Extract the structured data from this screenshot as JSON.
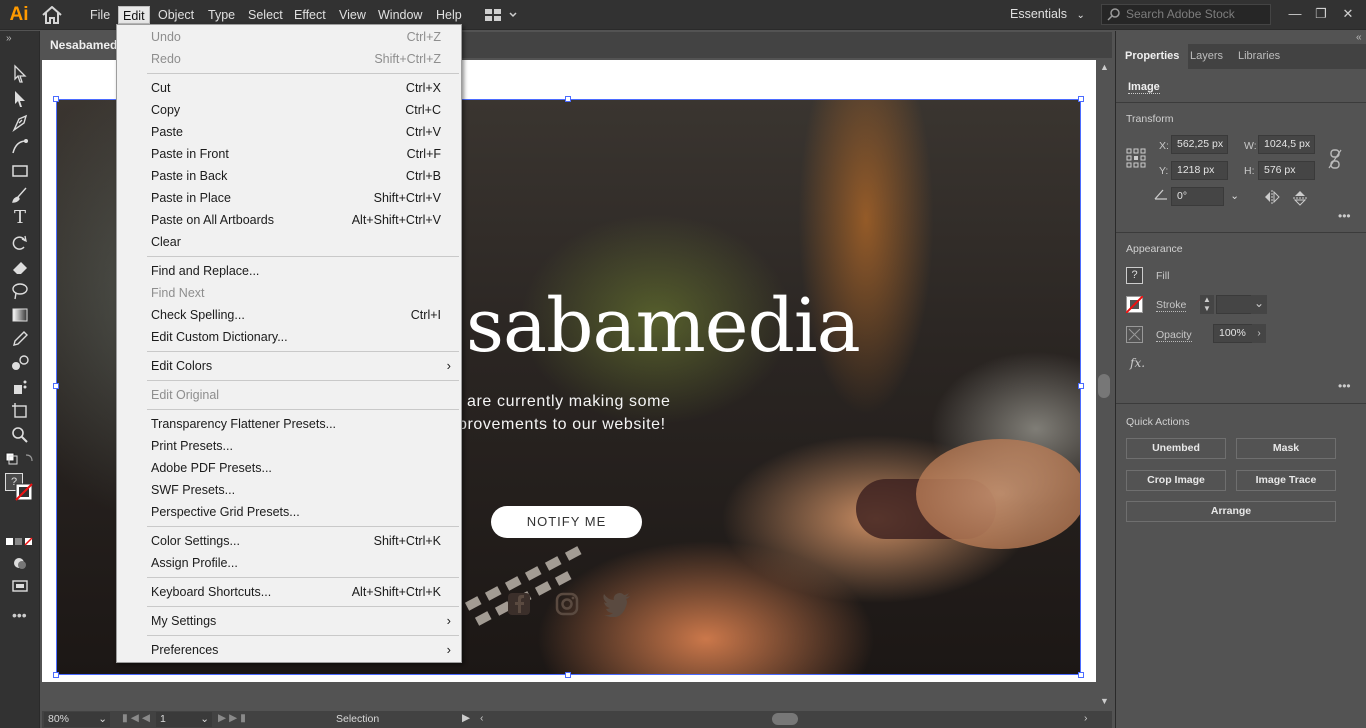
{
  "app": {
    "logo": "Ai",
    "menus": [
      "File",
      "Edit",
      "Object",
      "Type",
      "Select",
      "Effect",
      "View",
      "Window",
      "Help"
    ],
    "active_menu": "Edit",
    "workspace": "Essentials",
    "search_placeholder": "Search Adobe Stock"
  },
  "document": {
    "tab_label": "Nesabamedi"
  },
  "artwork": {
    "title": "sabamedia",
    "subtitle_line1": "are currently making some",
    "subtitle_line2": "provements to our website!",
    "button": "NOTIFY ME"
  },
  "edit_menu": [
    {
      "label": "Undo",
      "shortcut": "Ctrl+Z",
      "disabled": true
    },
    {
      "label": "Redo",
      "shortcut": "Shift+Ctrl+Z",
      "disabled": true
    },
    {
      "sep": true
    },
    {
      "label": "Cut",
      "shortcut": "Ctrl+X"
    },
    {
      "label": "Copy",
      "shortcut": "Ctrl+C"
    },
    {
      "label": "Paste",
      "shortcut": "Ctrl+V"
    },
    {
      "label": "Paste in Front",
      "shortcut": "Ctrl+F"
    },
    {
      "label": "Paste in Back",
      "shortcut": "Ctrl+B"
    },
    {
      "label": "Paste in Place",
      "shortcut": "Shift+Ctrl+V"
    },
    {
      "label": "Paste on All Artboards",
      "shortcut": "Alt+Shift+Ctrl+V"
    },
    {
      "label": "Clear",
      "shortcut": ""
    },
    {
      "sep": true
    },
    {
      "label": "Find and Replace...",
      "shortcut": ""
    },
    {
      "label": "Find Next",
      "shortcut": "",
      "disabled": true
    },
    {
      "label": "Check Spelling...",
      "shortcut": "Ctrl+I"
    },
    {
      "label": "Edit Custom Dictionary...",
      "shortcut": ""
    },
    {
      "sep": true
    },
    {
      "label": "Edit Colors",
      "shortcut": "",
      "submenu": true
    },
    {
      "sep": true
    },
    {
      "label": "Edit Original",
      "shortcut": "",
      "disabled": true
    },
    {
      "sep": true
    },
    {
      "label": "Transparency Flattener Presets...",
      "shortcut": ""
    },
    {
      "label": "Print Presets...",
      "shortcut": ""
    },
    {
      "label": "Adobe PDF Presets...",
      "shortcut": ""
    },
    {
      "label": "SWF Presets...",
      "shortcut": ""
    },
    {
      "label": "Perspective Grid Presets...",
      "shortcut": ""
    },
    {
      "sep": true
    },
    {
      "label": "Color Settings...",
      "shortcut": "Shift+Ctrl+K"
    },
    {
      "label": "Assign Profile...",
      "shortcut": ""
    },
    {
      "sep": true
    },
    {
      "label": "Keyboard Shortcuts...",
      "shortcut": "Alt+Shift+Ctrl+K"
    },
    {
      "sep": true
    },
    {
      "label": "My Settings",
      "shortcut": "",
      "submenu": true
    },
    {
      "sep": true
    },
    {
      "label": "Preferences",
      "shortcut": "",
      "submenu": true
    }
  ],
  "panel": {
    "tabs": [
      "Properties",
      "Layers",
      "Libraries"
    ],
    "selection_type": "Image",
    "transform": {
      "title": "Transform",
      "x_label": "X:",
      "x": "562,25 px",
      "y_label": "Y:",
      "y": "1218 px",
      "w_label": "W:",
      "w": "1024,5 px",
      "h_label": "H:",
      "h": "576 px",
      "angle": "0°"
    },
    "appearance": {
      "title": "Appearance",
      "fill": "Fill",
      "stroke": "Stroke",
      "opacity_label": "Opacity",
      "opacity": "100%",
      "fx": "fx."
    },
    "quick_actions": {
      "title": "Quick Actions",
      "unembed": "Unembed",
      "mask": "Mask",
      "crop": "Crop Image",
      "trace": "Image Trace",
      "arrange": "Arrange"
    }
  },
  "status": {
    "zoom": "80%",
    "artboard_num": "1",
    "tool": "Selection"
  },
  "colors": {
    "accent_selection": "#4b6bff",
    "logo": "#ff9a00"
  }
}
